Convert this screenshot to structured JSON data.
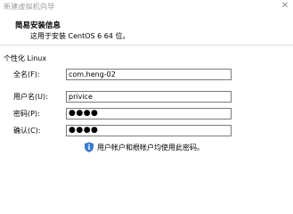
{
  "window": {
    "title": "新建虚拟机向导",
    "close_glyph": "✕"
  },
  "header": {
    "title": "简易安装信息",
    "subtitle": "这用于安装 CentOS 6 64 位。"
  },
  "personalize": {
    "section_label": "个性化 Linux",
    "full_name": {
      "label": "全名(F):",
      "value": "com.heng-02"
    },
    "username": {
      "label": "用户名(U):",
      "value": "privice"
    },
    "password": {
      "label": "密码(P):",
      "value": "●●●●"
    },
    "confirm": {
      "label": "确认(C):",
      "value": "●●●●"
    },
    "info": {
      "icon": "info-shield-icon",
      "text": "用户帐户和根帐户均使用此密码。"
    }
  }
}
